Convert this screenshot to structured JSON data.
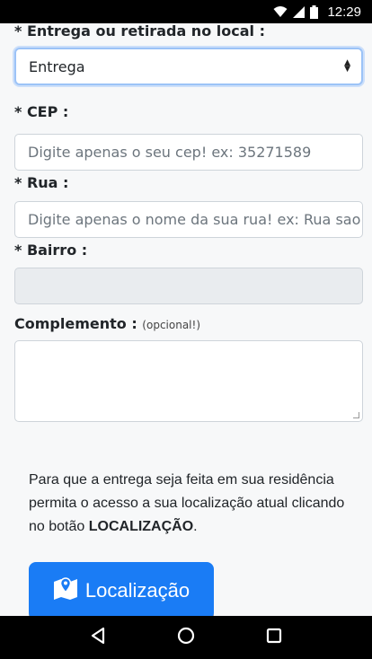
{
  "status_bar": {
    "time": "12:29"
  },
  "form": {
    "delivery": {
      "label": "* Entrega ou retirada no local :",
      "value": "Entrega"
    },
    "cep": {
      "label": "* CEP :",
      "placeholder": "Digite apenas o seu cep! ex: 35271589"
    },
    "rua": {
      "label": "* Rua :",
      "placeholder": "Digite apenas o nome da sua rua! ex: Rua sao lu"
    },
    "bairro": {
      "label": "* Bairro :",
      "value": ""
    },
    "complemento": {
      "label": "Complemento :",
      "hint": "(opcional!)"
    }
  },
  "info": {
    "text_before": "Para que a entrega seja feita em sua residência permita o acesso a sua localização atual clicando no botão ",
    "highlight": "LOCALIZAÇÃO",
    "text_after": "."
  },
  "location_button": {
    "label": "Localização",
    "icon": "map-marker-icon"
  },
  "colors": {
    "primary": "#1a7cf5",
    "status_bar": "#000000"
  }
}
